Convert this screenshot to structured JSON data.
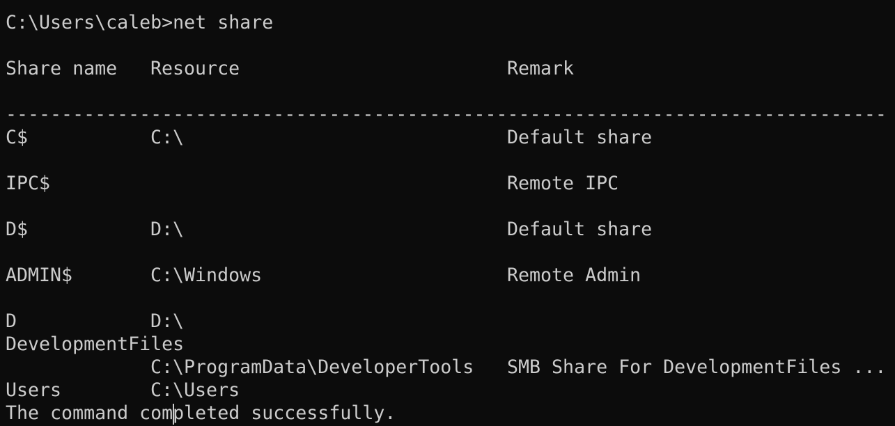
{
  "prompt": "C:\\Users\\caleb>",
  "command": "net share",
  "headers": {
    "share_name": "Share name",
    "resource": "Resource",
    "remark": "Remark"
  },
  "divider": "-------------------------------------------------------------------------------",
  "rows": [
    {
      "name": "C$",
      "resource": "C:\\",
      "remark": "Default share"
    },
    {
      "name": "IPC$",
      "resource": "",
      "remark": "Remote IPC"
    },
    {
      "name": "D$",
      "resource": "D:\\",
      "remark": "Default share"
    },
    {
      "name": "ADMIN$",
      "resource": "C:\\Windows",
      "remark": "Remote Admin"
    },
    {
      "name": "D",
      "resource": "D:\\",
      "remark": ""
    },
    {
      "name": "DevelopmentFiles",
      "resource": "C:\\ProgramData\\DeveloperTools",
      "remark": "SMB Share For DevelopmentFiles ..."
    },
    {
      "name": "Users",
      "resource": "C:\\Users",
      "remark": ""
    }
  ],
  "status": "The command completed successfully.",
  "colors": {
    "background": "#0c0c0c",
    "foreground": "#cccccc"
  }
}
